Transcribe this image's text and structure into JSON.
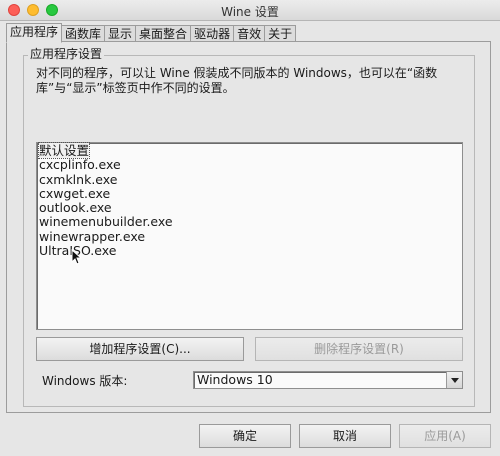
{
  "window": {
    "title": "Wine 设置"
  },
  "tabs": [
    {
      "label": "应用程序",
      "active": true
    },
    {
      "label": "函数库",
      "active": false
    },
    {
      "label": "显示",
      "active": false
    },
    {
      "label": "桌面整合",
      "active": false
    },
    {
      "label": "驱动器",
      "active": false
    },
    {
      "label": "音效",
      "active": false
    },
    {
      "label": "关于",
      "active": false
    }
  ],
  "apps": {
    "group_title": "应用程序设置",
    "description": "对不同的程序，可以让 Wine 假装成不同版本的 Windows，也可以在“函数库”与“显示”标签页中作不同的设置。",
    "list": [
      "默认设置",
      "cxcplinfo.exe",
      "cxmklnk.exe",
      "cxwget.exe",
      "outlook.exe",
      "winemenubuilder.exe",
      "winewrapper.exe",
      "UltraISO.exe"
    ],
    "selected_index": 0,
    "add_button": "增加程序设置(C)...",
    "remove_button": "删除程序设置(R)",
    "version_label": "Windows 版本:",
    "version_value": "Windows 10"
  },
  "footer": {
    "ok": "确定",
    "cancel": "取消",
    "apply": "应用(A)"
  },
  "icons": {
    "close": "close-dot",
    "minimize": "minimize-dot",
    "maximize": "maximize-dot",
    "dropdown": "chevron-down-icon",
    "cursor": "mouse-pointer-icon"
  },
  "colors": {
    "close": "#fd5f57",
    "minimize": "#febc2e",
    "maximize": "#28c840"
  }
}
